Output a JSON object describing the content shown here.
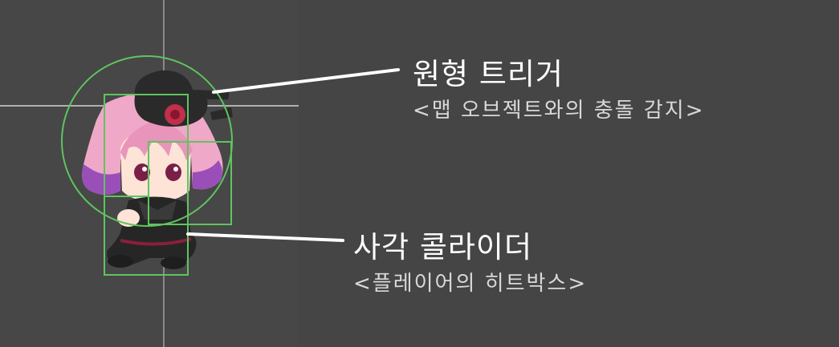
{
  "annotations": {
    "circle_trigger": {
      "title": "원형 트리거",
      "description": "<맵 오브젝트와의 충돌 감지>"
    },
    "box_collider": {
      "title": "사각 콜라이더",
      "description": "<플레이어의 히트박스>"
    }
  },
  "colors": {
    "background": "#454545",
    "collider_outline": "#5fc45f",
    "guide_line": "#bdbdbd",
    "callout_line": "#ffffff",
    "character_hair": "#f0a8c8",
    "character_hair_tips": "#9a4fb8",
    "character_hat": "#2a2a2a",
    "character_rose": "#c0304a",
    "character_outfit": "#262626"
  },
  "icons": {
    "character": "chibi-character-sprite"
  }
}
